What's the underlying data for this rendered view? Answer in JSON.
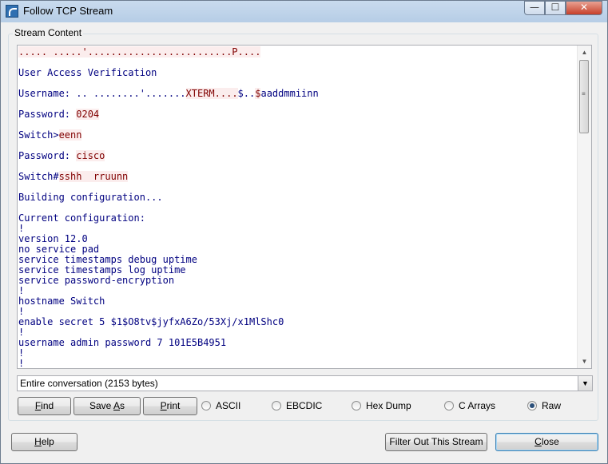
{
  "window": {
    "title": "Follow TCP Stream",
    "min_glyph": "—",
    "max_glyph": "☐",
    "close_glyph": "✕"
  },
  "group_label": "Stream Content",
  "stream": [
    [
      {
        "t": "..... .....'.........................P....",
        "k": "s"
      }
    ],
    [
      {
        "t": "",
        "k": "c"
      }
    ],
    [
      {
        "t": "User Access Verification",
        "k": "c"
      }
    ],
    [
      {
        "t": "",
        "k": "c"
      }
    ],
    [
      {
        "t": "Username: .. ........'.......",
        "k": "c"
      },
      {
        "t": "XTERM....",
        "k": "s"
      },
      {
        "t": "$..",
        "k": "c"
      },
      {
        "t": "$",
        "k": "s"
      },
      {
        "t": "aaddmmiinn",
        "k": "c"
      }
    ],
    [
      {
        "t": "",
        "k": "c"
      }
    ],
    [
      {
        "t": "Password: ",
        "k": "c"
      },
      {
        "t": "0204",
        "k": "s"
      }
    ],
    [
      {
        "t": "",
        "k": "c"
      }
    ],
    [
      {
        "t": "Switch>",
        "k": "c"
      },
      {
        "t": "eenn",
        "k": "s"
      }
    ],
    [
      {
        "t": "",
        "k": "c"
      }
    ],
    [
      {
        "t": "Password: ",
        "k": "c"
      },
      {
        "t": "cisco",
        "k": "s"
      }
    ],
    [
      {
        "t": "",
        "k": "c"
      }
    ],
    [
      {
        "t": "Switch#",
        "k": "c"
      },
      {
        "t": "sshh  rruunn",
        "k": "s"
      }
    ],
    [
      {
        "t": "",
        "k": "c"
      }
    ],
    [
      {
        "t": "Building configuration...",
        "k": "c"
      }
    ],
    [
      {
        "t": "",
        "k": "c"
      }
    ],
    [
      {
        "t": "Current configuration:",
        "k": "c"
      }
    ],
    [
      {
        "t": "!",
        "k": "c"
      }
    ],
    [
      {
        "t": "version 12.0",
        "k": "c"
      }
    ],
    [
      {
        "t": "no service pad",
        "k": "c"
      }
    ],
    [
      {
        "t": "service timestamps debug uptime",
        "k": "c"
      }
    ],
    [
      {
        "t": "service timestamps log uptime",
        "k": "c"
      }
    ],
    [
      {
        "t": "service password-encryption",
        "k": "c"
      }
    ],
    [
      {
        "t": "!",
        "k": "c"
      }
    ],
    [
      {
        "t": "hostname Switch",
        "k": "c"
      }
    ],
    [
      {
        "t": "!",
        "k": "c"
      }
    ],
    [
      {
        "t": "enable secret 5 $1$O8tv$jyfxA6Zo/53Xj/x1MlShc0",
        "k": "c"
      }
    ],
    [
      {
        "t": "!",
        "k": "c"
      }
    ],
    [
      {
        "t": "username admin password 7 101E5B4951",
        "k": "c"
      }
    ],
    [
      {
        "t": "!",
        "k": "c"
      }
    ],
    [
      {
        "t": "!",
        "k": "c"
      }
    ]
  ],
  "conversation_select": {
    "value": "Entire conversation (2153 bytes)"
  },
  "buttons": {
    "find": {
      "mn": "F",
      "rest": "ind"
    },
    "save_as": {
      "pre": "Save ",
      "mn": "A",
      "rest": "s"
    },
    "print": {
      "mn": "P",
      "rest": "rint"
    },
    "help": {
      "mn": "H",
      "rest": "elp"
    },
    "filter": "Filter Out This Stream",
    "close": {
      "mn": "C",
      "rest": "lose"
    }
  },
  "formats": [
    "ASCII",
    "EBCDIC",
    "Hex Dump",
    "C Arrays",
    "Raw"
  ],
  "selected_format": "Raw",
  "scroll_glyphs": {
    "up": "▲",
    "down": "▼",
    "combo": "▼"
  }
}
